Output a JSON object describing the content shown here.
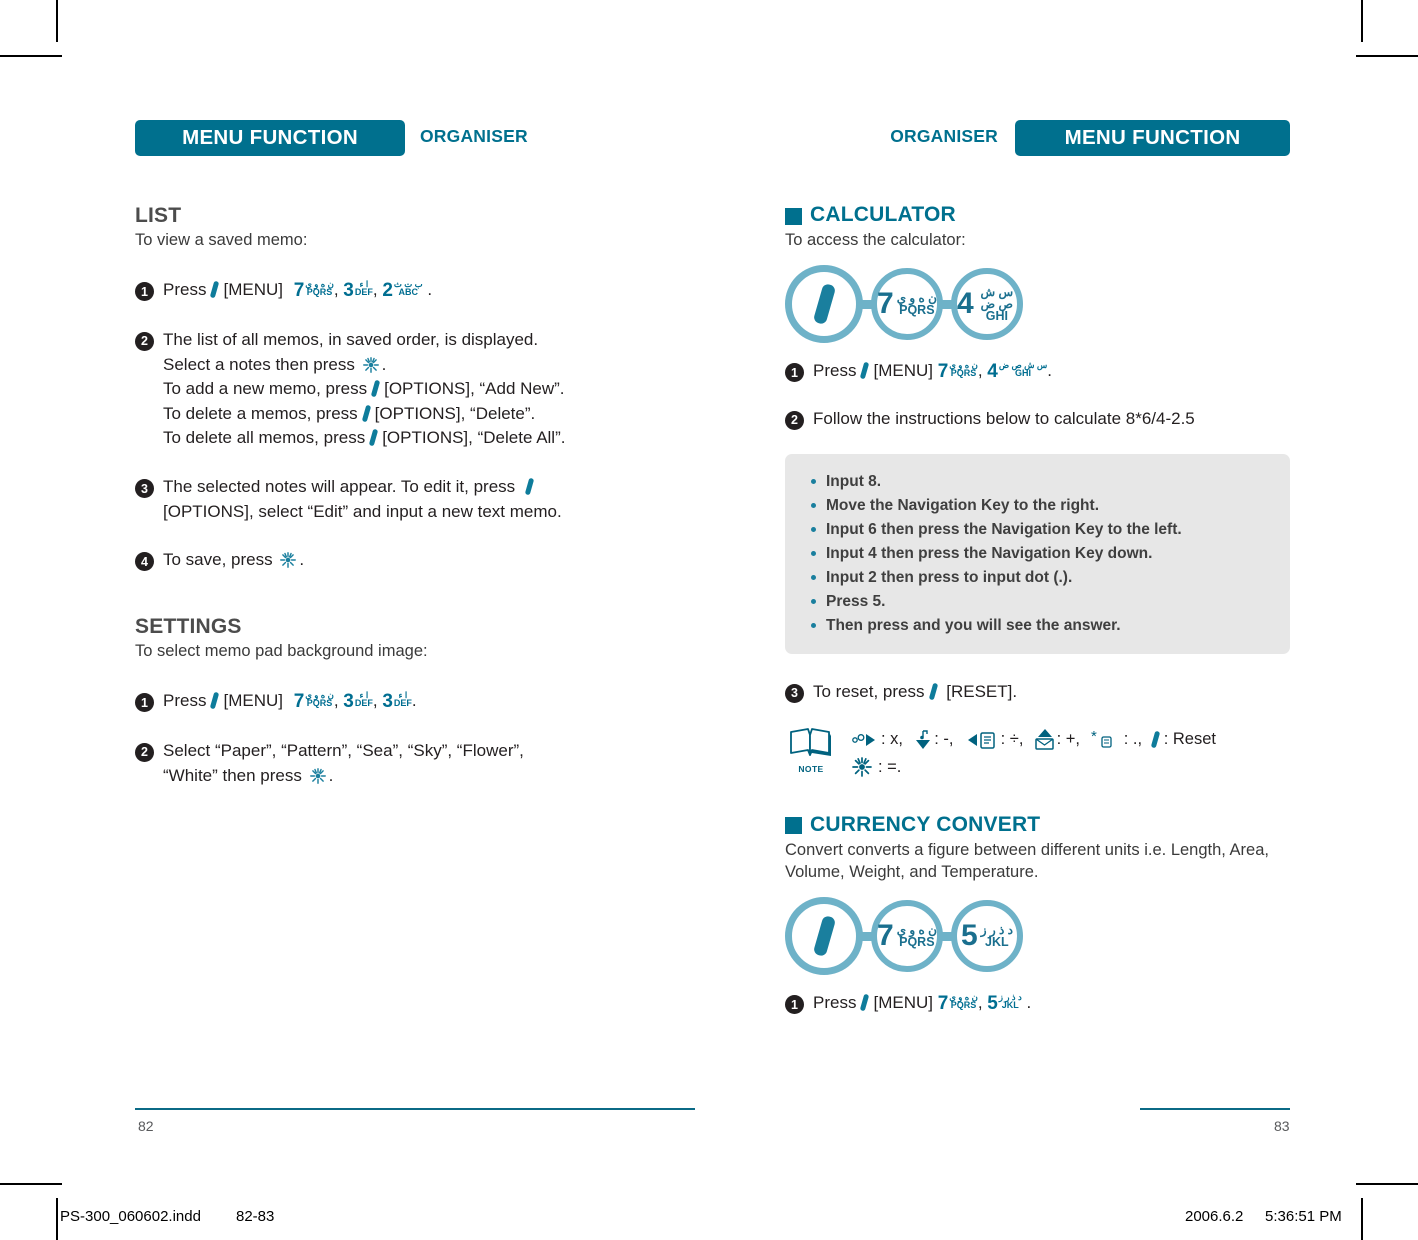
{
  "header": {
    "left": {
      "bar_label": "MENU FUNCTION",
      "sub_label": "ORGANISER"
    },
    "right": {
      "bar_label": "MENU FUNCTION",
      "sub_label": "ORGANISER"
    }
  },
  "colors": {
    "teal": "#00708E",
    "ring_blue": "#6EB2C8",
    "key_blue": "#1a6f8e",
    "tipbox_gray": "#e7e7e7",
    "step_black": "#231f20"
  },
  "left_page": {
    "list": {
      "title": "LIST",
      "subtitle": "To view a saved memo:",
      "steps": [
        {
          "num": "1",
          "prefix": "Press",
          "menu": "[MENU]",
          "keys": [
            {
              "digit": "7",
              "arabic": "ن ه و ي",
              "latin": "PQRS"
            },
            {
              "digit": "3",
              "arabic": "ا ء",
              "latin": "DEF"
            },
            {
              "digit": "2",
              "arabic": "ب ت ث",
              "latin": "ABC"
            }
          ],
          "suffix": "."
        },
        {
          "num": "2",
          "lines": [
            "The list of all memos, in saved order, is displayed.",
            "Select a notes then press",
            "To add a new memo, press",
            "To delete a memos, press",
            "To delete all memos, press"
          ],
          "line2_tail": ".",
          "line3_tail": "[OPTIONS], “Add New”.",
          "line4_tail": "[OPTIONS], “Delete”.",
          "line5_tail": "[OPTIONS], “Delete All”."
        },
        {
          "num": "3",
          "line1": "The selected notes will appear. To edit it, press",
          "line2": "[OPTIONS], select “Edit” and input a new text memo."
        },
        {
          "num": "4",
          "line1": "To save, press",
          "tail": "."
        }
      ]
    },
    "settings": {
      "title": "SETTINGS",
      "subtitle": "To select memo pad background image:",
      "steps": [
        {
          "num": "1",
          "prefix": "Press",
          "menu": "[MENU]",
          "keys": [
            {
              "digit": "7",
              "arabic": "ن ه و ي",
              "latin": "PQRS"
            },
            {
              "digit": "3",
              "arabic": "ا ء",
              "latin": "DEF"
            },
            {
              "digit": "3",
              "arabic": "ا ء",
              "latin": "DEF"
            }
          ],
          "suffix": "."
        },
        {
          "num": "2",
          "line1": "Select “Paper”, “Pattern”, “Sea”, “Sky”, “Flower”,",
          "line2": "“White” then press",
          "tail": "."
        }
      ]
    },
    "folio": "82"
  },
  "right_page": {
    "calculator": {
      "title": "CALCULATOR",
      "subtitle": "To access the calculator:",
      "keychain": [
        {
          "type": "slash"
        },
        {
          "type": "key",
          "digit": "7",
          "arabic": "ن ه و ي",
          "latin": "PQRS"
        },
        {
          "type": "key",
          "digit": "4",
          "arabic": "س ش ص ض",
          "latin": "GHI"
        }
      ],
      "step1": {
        "num": "1",
        "prefix": "Press",
        "menu": "[MENU]",
        "keys": [
          {
            "digit": "7",
            "arabic": "ن ه و ي",
            "latin": "PQRS"
          },
          {
            "digit": "4",
            "arabic": "س ش ص ض",
            "latin": "GHI"
          }
        ],
        "suffix": "."
      },
      "step2": {
        "num": "2",
        "text": "Follow the instructions below to calculate 8*6/4-2.5"
      },
      "tips": [
        "Input 8.",
        "Move the Navigation Key to the right.",
        "Input 6 then press the Navigation Key to the left.",
        "Input 4 then press the Navigation Key down.",
        "Input 2 then press to input dot (.).",
        "Press 5.",
        "Then press and you will see the answer."
      ],
      "step3": {
        "num": "3",
        "prefix": "To reset, press",
        "tail": "[RESET]."
      },
      "note": {
        "icon_label": "NOTE",
        "row1": [
          {
            "icon": "nav-right-icon",
            "label": ": x,"
          },
          {
            "icon": "nav-down-icon",
            "label": ": -,"
          },
          {
            "icon": "nav-left-icon",
            "label": ": ÷,"
          },
          {
            "icon": "nav-up-icon",
            "label": ": +,"
          },
          {
            "icon": "star-key-icon",
            "label": ": .,"
          },
          {
            "icon": "slash-key-icon",
            "label": ": Reset"
          }
        ],
        "row2": [
          {
            "icon": "ok-key-icon",
            "label": ": =."
          }
        ]
      }
    },
    "currency": {
      "title": "CURRENCY CONVERT",
      "subtitle_line1": "Convert converts a figure between different units i.e. Length, Area,",
      "subtitle_line2": "Volume, Weight, and Temperature.",
      "keychain": [
        {
          "type": "slash"
        },
        {
          "type": "key",
          "digit": "7",
          "arabic": "ن ه و ي",
          "latin": "PQRS"
        },
        {
          "type": "key",
          "digit": "5",
          "arabic": "د ذ ر ز",
          "latin": "JKL"
        }
      ],
      "step1": {
        "num": "1",
        "prefix": "Press",
        "menu": "[MENU]",
        "keys": [
          {
            "digit": "7",
            "arabic": "ن ه و ي",
            "latin": "PQRS"
          },
          {
            "digit": "5",
            "arabic": "د ذ ر ز",
            "latin": "JKL"
          }
        ],
        "suffix": "."
      }
    },
    "folio": "83"
  },
  "imprint": {
    "filename": "PS-300_060602.indd",
    "pages": "82-83",
    "date": "2006.6.2",
    "time": "5:36:51 PM"
  }
}
